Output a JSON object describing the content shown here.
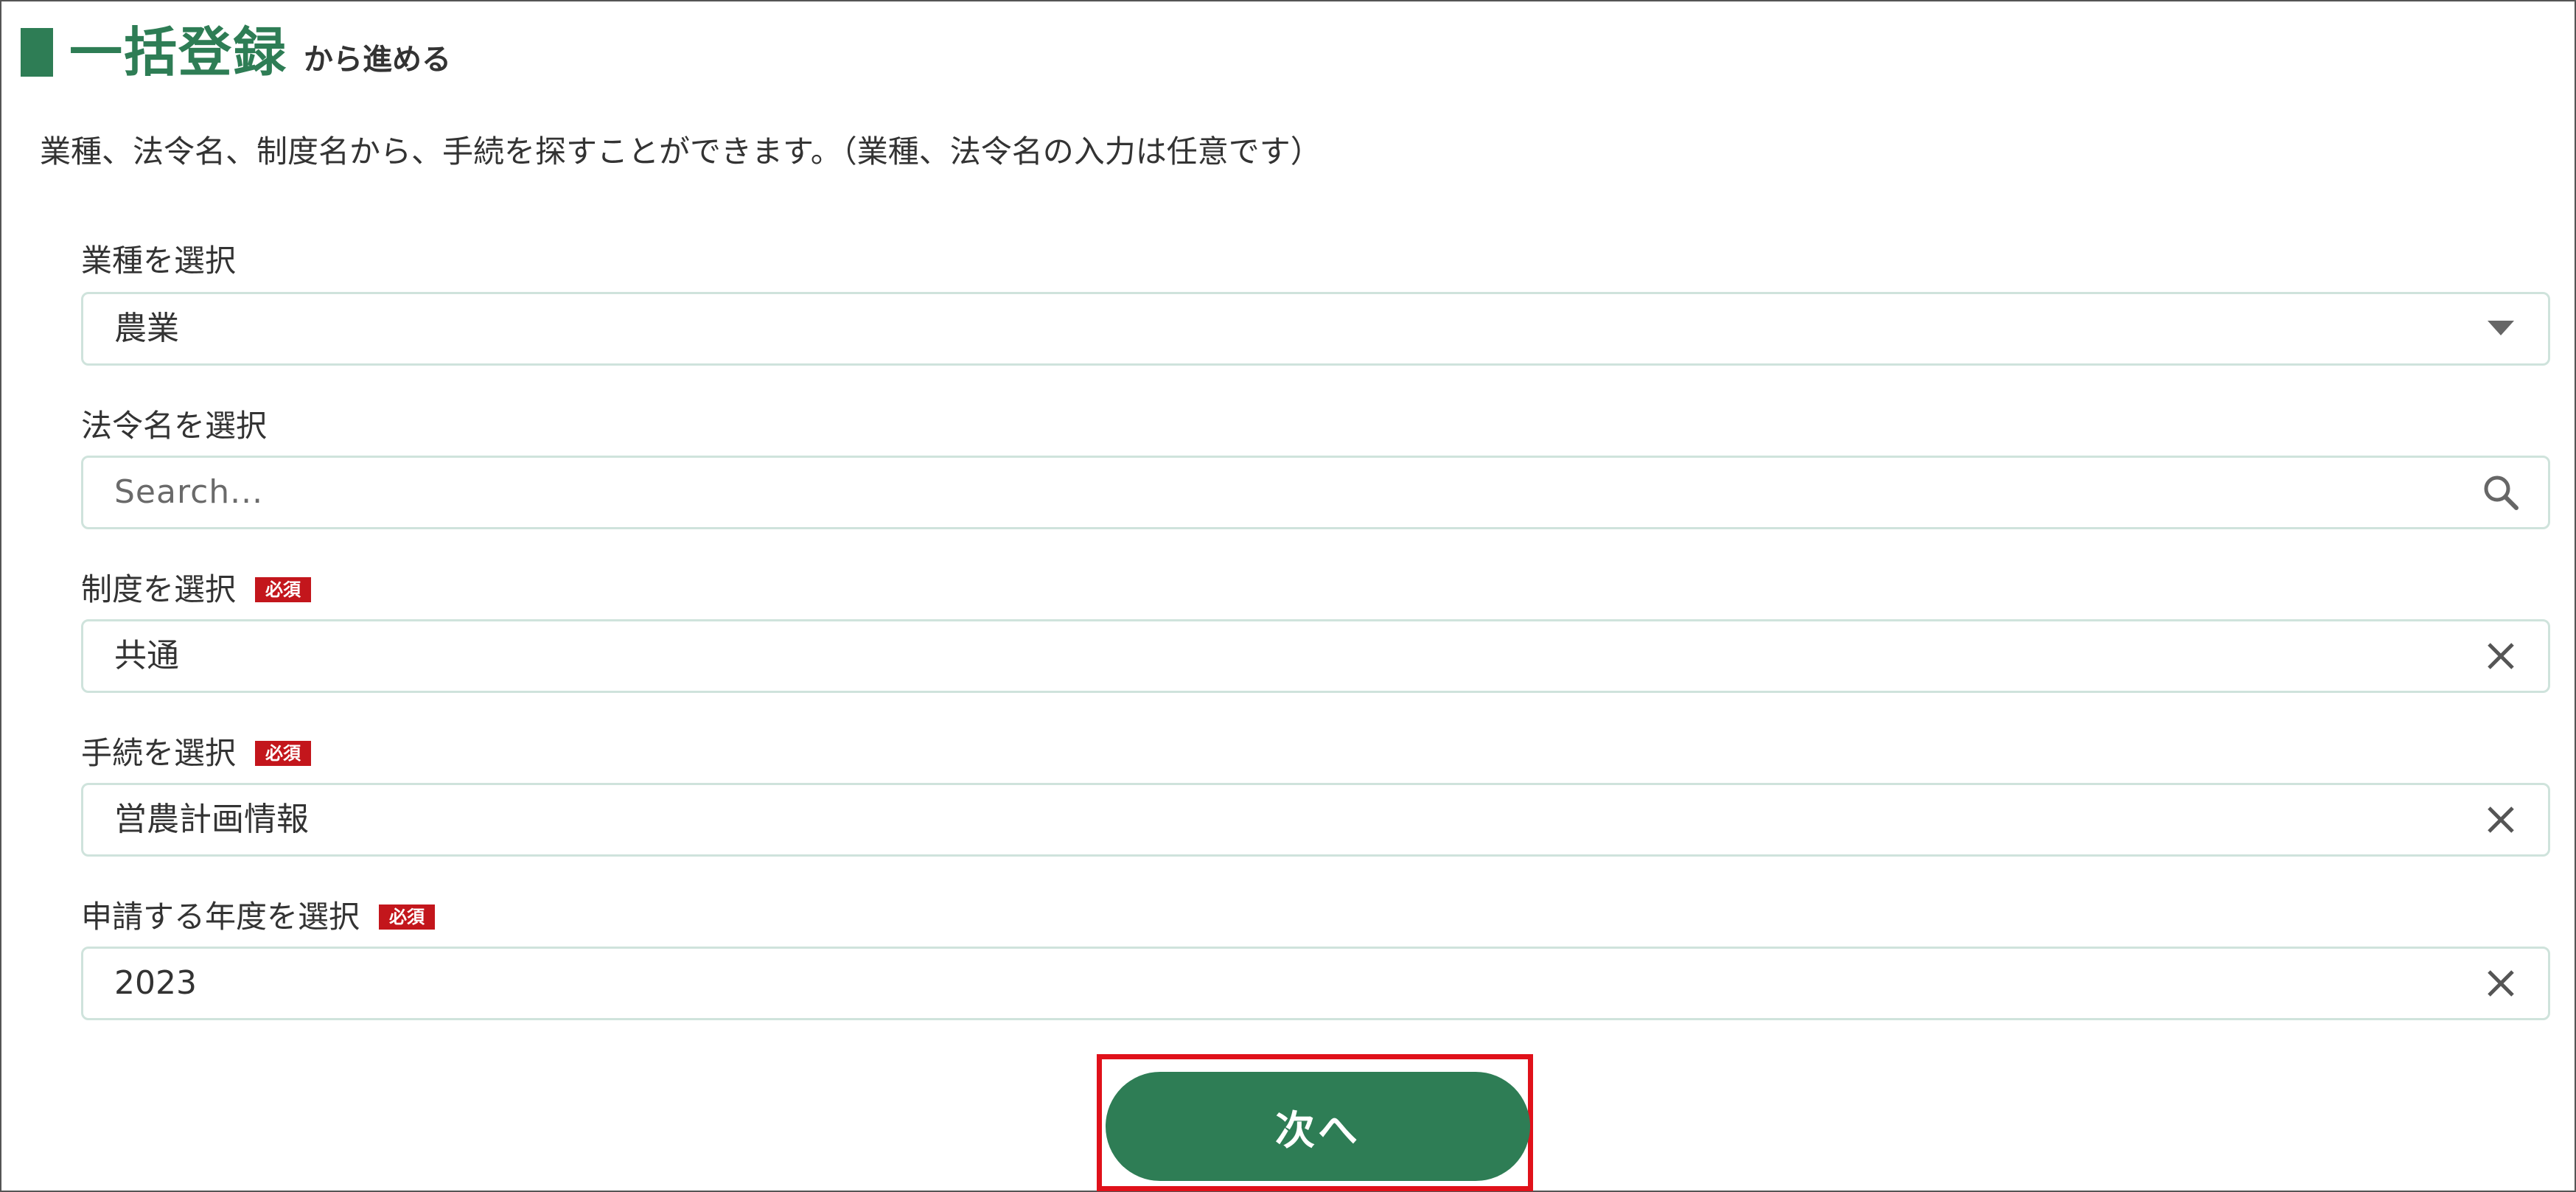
{
  "header": {
    "title": "一括登録",
    "suffix": "から進める",
    "accent_color": "#2e7d55"
  },
  "description": "業種、法令名、制度名から、手続を探すことができます。（業種、法令名の入力は任意です）",
  "fields": {
    "industry": {
      "label": "業種を選択",
      "value": "農業",
      "icon": "dropdown-triangle-icon"
    },
    "law": {
      "label": "法令名を選択",
      "placeholder": "Search...",
      "icon": "search-icon"
    },
    "system": {
      "label": "制度を選択",
      "required_badge": "必須",
      "value": "共通",
      "icon": "clear-icon"
    },
    "procedure": {
      "label": "手続を選択",
      "required_badge": "必須",
      "value": "営農計画情報",
      "icon": "clear-icon"
    },
    "year": {
      "label": "申請する年度を選択",
      "required_badge": "必須",
      "value": "2023",
      "icon": "clear-icon"
    }
  },
  "actions": {
    "next_label": "次へ",
    "highlight_color": "#e0111a",
    "required_color": "#c3161c"
  }
}
